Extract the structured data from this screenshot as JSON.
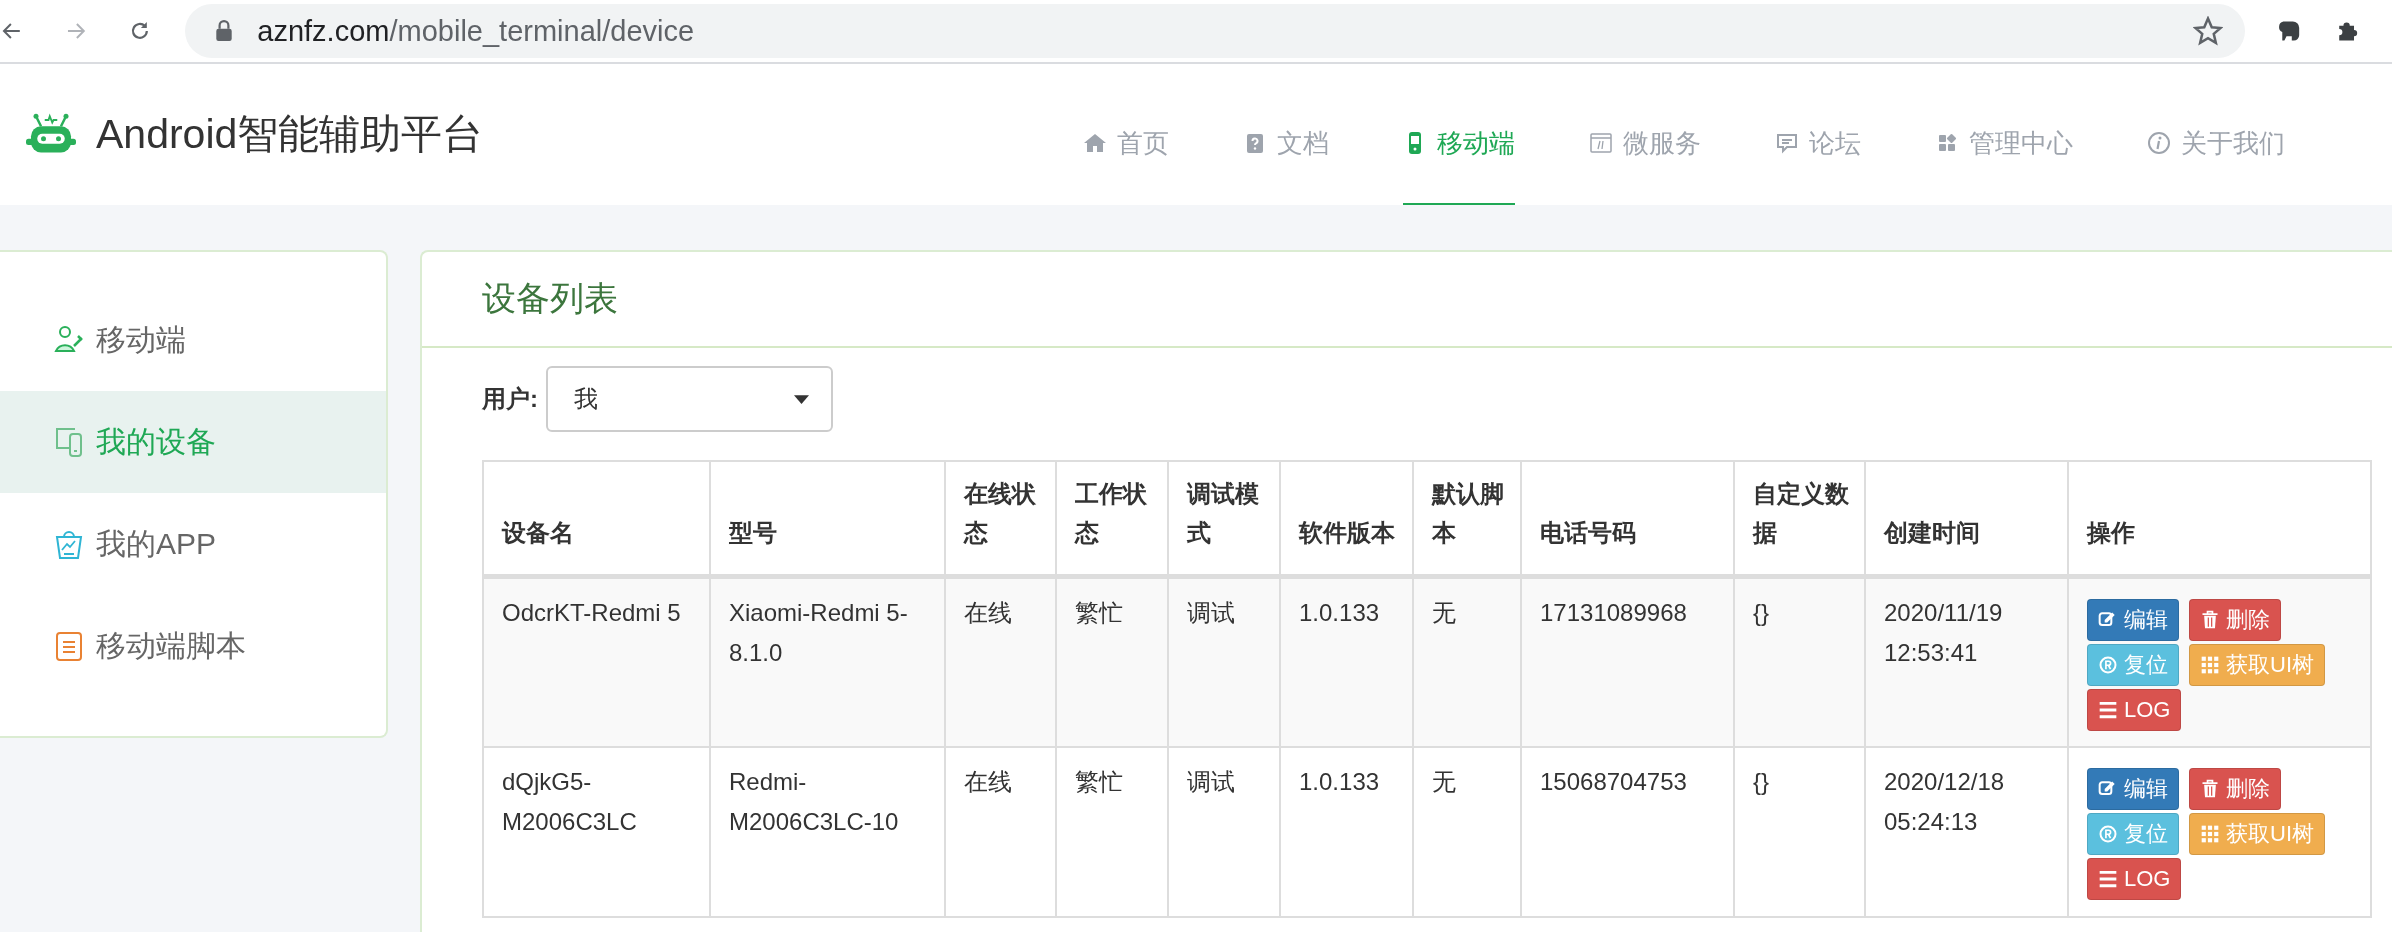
{
  "browser": {
    "url_host": "aznfz.com",
    "url_path": "/mobile_terminal/device"
  },
  "header": {
    "title": "Android智能辅助平台",
    "nav": [
      {
        "label": "首页",
        "selected": false
      },
      {
        "label": "文档",
        "selected": false
      },
      {
        "label": "移动端",
        "selected": true
      },
      {
        "label": "微服务",
        "selected": false
      },
      {
        "label": "论坛",
        "selected": false
      },
      {
        "label": "管理中心",
        "selected": false
      },
      {
        "label": "关于我们",
        "selected": false
      }
    ]
  },
  "sidebar": {
    "items": [
      {
        "label": "移动端",
        "selected": false
      },
      {
        "label": "我的设备",
        "selected": true
      },
      {
        "label": "我的APP",
        "selected": false
      },
      {
        "label": "移动端脚本",
        "selected": false
      }
    ]
  },
  "panel": {
    "title": "设备列表",
    "user_filter": {
      "label": "用户:",
      "value": "我"
    },
    "table": {
      "columns": [
        "设备名",
        "型号",
        "在线状态",
        "工作状态",
        "调试模式",
        "软件版本",
        "默认脚本",
        "电话号码",
        "自定义数据",
        "创建时间",
        "操作"
      ],
      "rows": [
        {
          "cells": [
            "OdcrKT-Redmi 5",
            "Xiaomi-Redmi 5-8.1.0",
            "在线",
            "繁忙",
            "调试",
            "1.0.133",
            "无",
            "17131089968",
            "{}",
            "2020/11/19 12:53:41"
          ],
          "actions": [
            {
              "label": "编辑",
              "kind": "edit"
            },
            {
              "label": "删除",
              "kind": "delete"
            },
            {
              "label": "复位",
              "kind": "reset"
            },
            {
              "label": "获取UI树",
              "kind": "tree"
            },
            {
              "label": "LOG",
              "kind": "log"
            }
          ]
        },
        {
          "cells": [
            "dQjkG5-M2006C3LC",
            "Redmi-M2006C3LC-10",
            "在线",
            "繁忙",
            "调试",
            "1.0.133",
            "无",
            "15068704753",
            "{}",
            "2020/12/18 05:24:13"
          ],
          "actions": [
            {
              "label": "编辑",
              "kind": "edit"
            },
            {
              "label": "删除",
              "kind": "delete"
            },
            {
              "label": "复位",
              "kind": "reset"
            },
            {
              "label": "获取UI树",
              "kind": "tree"
            },
            {
              "label": "LOG",
              "kind": "log"
            }
          ]
        }
      ]
    }
  }
}
